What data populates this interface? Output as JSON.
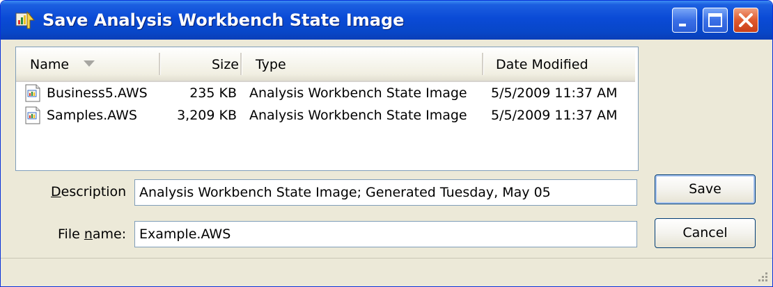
{
  "window": {
    "title": "Save Analysis Workbench State Image"
  },
  "file_list": {
    "columns": [
      "Name",
      "Size",
      "Type",
      "Date Modified"
    ],
    "sorted_by": "Name",
    "rows": [
      {
        "name": "Business5.AWS",
        "size": "235 KB",
        "type": "Analysis Workbench State Image",
        "date": "5/5/2009 11:37 AM"
      },
      {
        "name": "Samples.AWS",
        "size": "3,209 KB",
        "type": "Analysis Workbench State Image",
        "date": "5/5/2009 11:37 AM"
      }
    ]
  },
  "form": {
    "description_label": "Description",
    "description_value": "Analysis Workbench State Image; Generated Tuesday, May 05",
    "filename_label": "File name:",
    "filename_value": "Example.AWS"
  },
  "buttons": {
    "save": "Save",
    "cancel": "Cancel"
  },
  "colors": {
    "titlebar": "#0a4ad6",
    "close_button": "#e05a2e",
    "dialog_background": "#ece9d8"
  }
}
